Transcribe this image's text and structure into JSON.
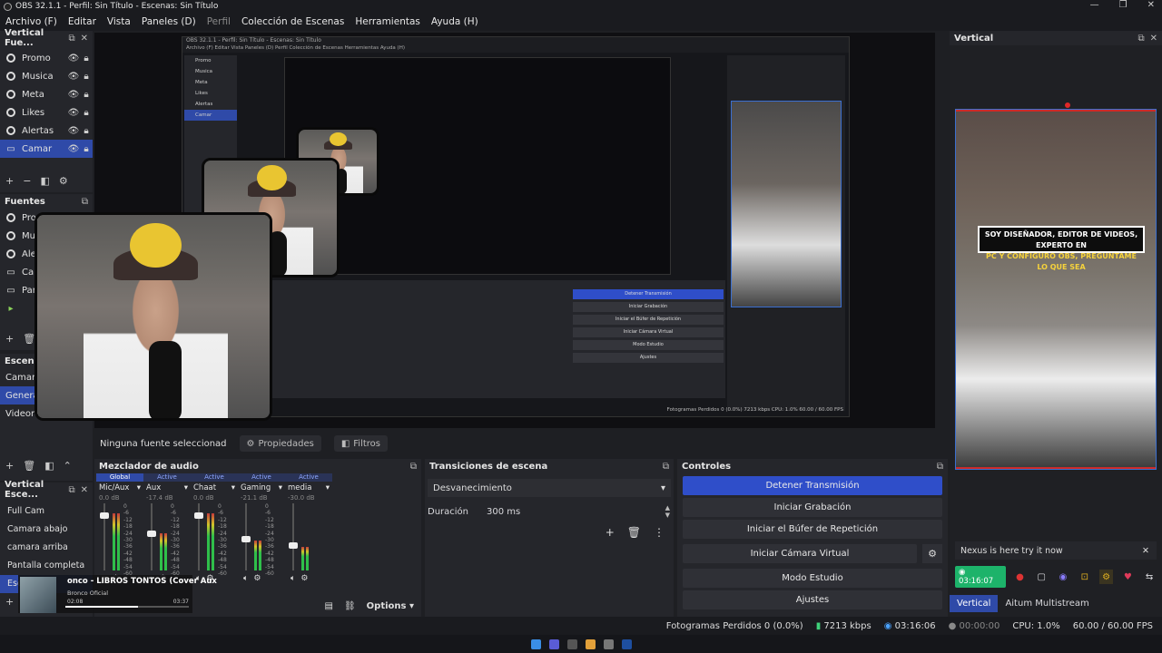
{
  "window": {
    "title": "OBS 32.1.1 - Perfil: Sin Título - Escenas: Sin Título",
    "controls": [
      "—",
      "❐",
      "✕"
    ]
  },
  "menu": {
    "items": [
      "Archivo (F)",
      "Editar",
      "Vista",
      "Paneles (D)",
      "Perfil",
      "Colección de Escenas",
      "Herramientas",
      "Ayuda (H)"
    ]
  },
  "vertical_sources": {
    "title": "Vertical Fue...",
    "items": [
      {
        "label": "Promo"
      },
      {
        "label": "Musica"
      },
      {
        "label": "Meta"
      },
      {
        "label": "Likes"
      },
      {
        "label": "Alertas"
      },
      {
        "label": "Camar"
      }
    ]
  },
  "sources": {
    "title": "Fuentes",
    "items": [
      "Promo",
      "Musi",
      "Aler",
      "Can",
      "Pan",
      ""
    ]
  },
  "scenes": {
    "title": "Escenas",
    "items": [
      "Camara",
      "General",
      "Videoreacci"
    ]
  },
  "vertical_scenes": {
    "title": "Vertical Esce...",
    "items": [
      "Full Cam",
      "Camara abajo",
      "camara arriba",
      "Pantalla completa",
      "Esc"
    ]
  },
  "preview": {
    "nested_title": "OBS 32.1.1 - Perfil: Sin Título - Escenas: Sin Título",
    "nested_menu": "Archivo (F)  Editar  Vista  Paneles (D)  Perfil  Colección de Escenas  Herramientas  Ayuda (H)",
    "nested_sources": [
      "Promo",
      "Musica",
      "Meta",
      "Likes",
      "Alertas",
      "Camar"
    ],
    "nested_controls": [
      "Detener Transmisión",
      "Iniciar Grabación",
      "Iniciar el Búfer de Repetición",
      "Iniciar Cámara Virtual",
      "Modo Estudio",
      "Ajustes"
    ],
    "nested_status": "Fotogramas Perdidos 0 (0.0%)   7213 kbps   CPU: 1.0%   60.00 / 60.00 FPS"
  },
  "source_bar": {
    "none_selected": "Ninguna fuente seleccionad",
    "properties": "Propiedades",
    "filters": "Filtros"
  },
  "mixer": {
    "title": "Mezclador de audio",
    "channels": [
      {
        "tag": "Global",
        "name": "Mic/Aux",
        "db": "0.0 dB",
        "level": 0.85
      },
      {
        "tag": "Active",
        "name": "Aux",
        "db": "-17.4 dB",
        "level": 0.55
      },
      {
        "tag": "Active",
        "name": "Chaat",
        "db": "0.0 dB",
        "level": 0.85
      },
      {
        "tag": "Active",
        "name": "Gaming",
        "db": "-21.1 dB",
        "level": 0.45
      },
      {
        "tag": "Active",
        "name": "media",
        "db": "-30.0 dB",
        "level": 0.35
      }
    ],
    "scale": [
      "0",
      "-6",
      "-12",
      "-18",
      "-24",
      "-30",
      "-36",
      "-42",
      "-48",
      "-54",
      "-60"
    ],
    "options": "Options"
  },
  "transitions": {
    "title": "Transiciones de escena",
    "selected": "Desvanecimiento",
    "duration_label": "Duración",
    "duration_value": "300 ms"
  },
  "controls": {
    "title": "Controles",
    "stop_stream": "Detener Transmisión",
    "start_recording": "Iniciar Grabación",
    "start_replay": "Iniciar el Búfer de Repetición",
    "start_virtual_cam": "Iniciar Cámara Virtual",
    "studio_mode": "Modo Estudio",
    "settings": "Ajustes"
  },
  "vertical": {
    "title": "Vertical",
    "caption_line1": "SOY DISEÑADOR, EDITOR DE VIDEOS, EXPERTO EN",
    "caption_line2": "PC Y CONFIGURO OBS, PREGUNTAME LO QUE SEA",
    "nexus": "Nexus is here try it now",
    "live_time": "03:16:07",
    "tab_vertical": "Vertical",
    "tab_aitum": "Aitum Multistream"
  },
  "status": {
    "dropped": "Fotogramas Perdidos 0 (0.0%)",
    "bitrate": "7213 kbps",
    "stream_time": "03:16:06",
    "rec_time": "00:00:00",
    "cpu": "CPU: 1.0%",
    "fps": "60.00 / 60.00 FPS"
  },
  "media": {
    "title": "onco - LIBROS TONTOS (Cover Aux",
    "artist": "Bronco Oficial",
    "elapsed": "02:08",
    "total": "03:37",
    "progress": 0.59
  },
  "colors": {
    "accent": "#2f4aa8",
    "button_blue": "#2f4ec9",
    "live_green": "#1db36a",
    "border_blue": "#3b6fd0"
  }
}
